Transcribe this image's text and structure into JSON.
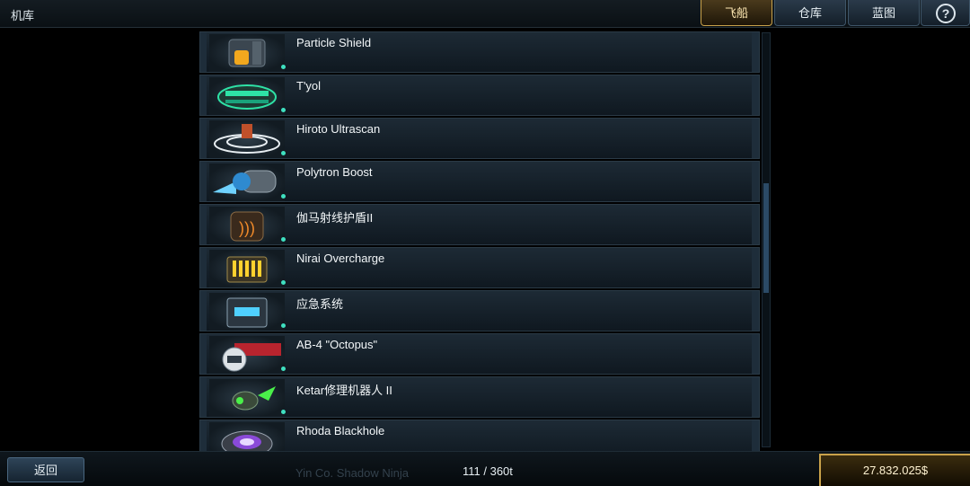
{
  "header": {
    "title": "机库",
    "tabs": [
      {
        "label": "飞船",
        "active": true
      },
      {
        "label": "仓库",
        "active": false
      },
      {
        "label": "蓝图",
        "active": false
      }
    ],
    "help_icon": "question-mark-icon"
  },
  "items": [
    {
      "name": "Particle Shield",
      "icon": "particle-shield-icon"
    },
    {
      "name": "T'yol",
      "icon": "tyol-icon"
    },
    {
      "name": "Hiroto Ultrascan",
      "icon": "ultrascan-icon"
    },
    {
      "name": "Polytron Boost",
      "icon": "boost-icon"
    },
    {
      "name": "伽马射线护盾II",
      "icon": "gamma-shield-icon"
    },
    {
      "name": "Nirai Overcharge",
      "icon": "overcharge-icon"
    },
    {
      "name": "应急系统",
      "icon": "emergency-system-icon"
    },
    {
      "name": "AB-4 \"Octopus\"",
      "icon": "octopus-icon"
    },
    {
      "name": "Ketar修理机器人 II",
      "icon": "repair-bot-icon"
    },
    {
      "name": "Rhoda Blackhole",
      "icon": "blackhole-icon"
    }
  ],
  "footer": {
    "back_label": "返回",
    "capacity": "111 / 360t",
    "money": "27.832.025$",
    "partial_item": "Yin Co. Shadow Ninja"
  },
  "colors": {
    "active_tab_border": "#c9a24a",
    "status_dot": "#3fe0c0"
  }
}
